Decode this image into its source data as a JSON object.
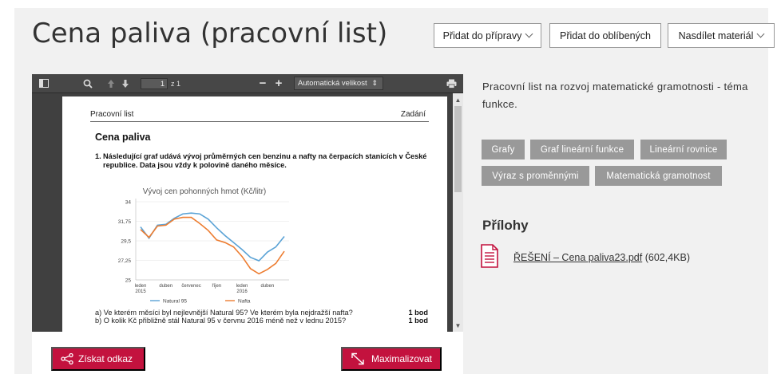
{
  "page": {
    "title": "Cena paliva (pracovní list)"
  },
  "actions": {
    "add_prep": "Přidat do přípravy",
    "add_fav": "Přidat do oblíbených",
    "share": "Nasdílet materiál"
  },
  "viewer": {
    "page_number": "1",
    "page_of": "z 1",
    "zoom_label": "Automatická velikost",
    "doc": {
      "header_left": "Pracovní list",
      "header_right": "Zadání",
      "title": "Cena paliva",
      "q1_num": "1.",
      "q1_line1": "Následující graf udává vývoj průměrných cen benzinu a nafty na čerpacích stanicích v České",
      "q1_line2": "republice. Data jsou vždy k polovině daného měsíce.",
      "qa": "a) Ve kterém měsíci byl nejlevnější Natural 95? Ve kterém byla nejdražší nafta?",
      "qa_pts": "1 bod",
      "qb": "b) O kolik Kč přibližně stál Natural 95 v červnu 2016 méně než v lednu 2015?",
      "qb_pts": "1 bod"
    }
  },
  "chart_data": {
    "type": "line",
    "title": "Vývoj cen pohonných hmot (Kč/litr)",
    "x_tick_labels": [
      "leden 2015",
      "duben",
      "červenec",
      "říjen",
      "leden 2016",
      "duben"
    ],
    "x": [
      1,
      2,
      3,
      4,
      5,
      6,
      7,
      8,
      9,
      10,
      11,
      12,
      13,
      14,
      15,
      16,
      17,
      18
    ],
    "ylim": [
      25,
      34
    ],
    "yticks": [
      "34",
      "31,75",
      "29,5",
      "27,25",
      "25"
    ],
    "series": [
      {
        "name": "Natural 95",
        "color": "#5ba3d6",
        "values": [
          31.1,
          29.8,
          31.3,
          31.4,
          32.1,
          32.6,
          32.7,
          32.6,
          32.0,
          31.0,
          30.1,
          29.3,
          28.5,
          27.6,
          27.2,
          28.2,
          28.8,
          30.0
        ]
      },
      {
        "name": "Nafta",
        "color": "#ed7d31",
        "values": [
          30.8,
          29.9,
          31.2,
          31.3,
          32.0,
          32.2,
          32.2,
          31.5,
          30.7,
          29.6,
          29.3,
          28.8,
          27.7,
          26.3,
          25.7,
          26.2,
          26.9,
          28.3
        ]
      }
    ],
    "grid": true,
    "legend": "bottom"
  },
  "bottom": {
    "get_link": "Získat odkaz",
    "maximize": "Maximalizovat"
  },
  "side": {
    "description": "Pracovní list na rozvoj matematické gramotnosti - téma funkce.",
    "tags": [
      "Grafy",
      "Graf lineární funkce",
      "Lineární rovnice",
      "Výraz s proměnnými",
      "Matematická gramotnost"
    ],
    "attachments_title": "Přílohy",
    "attachment_name": "ŘEŠENÍ – Cena paliva23.pdf",
    "attachment_size": "(602,4KB)"
  },
  "colors": {
    "accent": "#c3123e",
    "tag_bg": "#999999",
    "panel_bg": "#f1f1f1"
  }
}
